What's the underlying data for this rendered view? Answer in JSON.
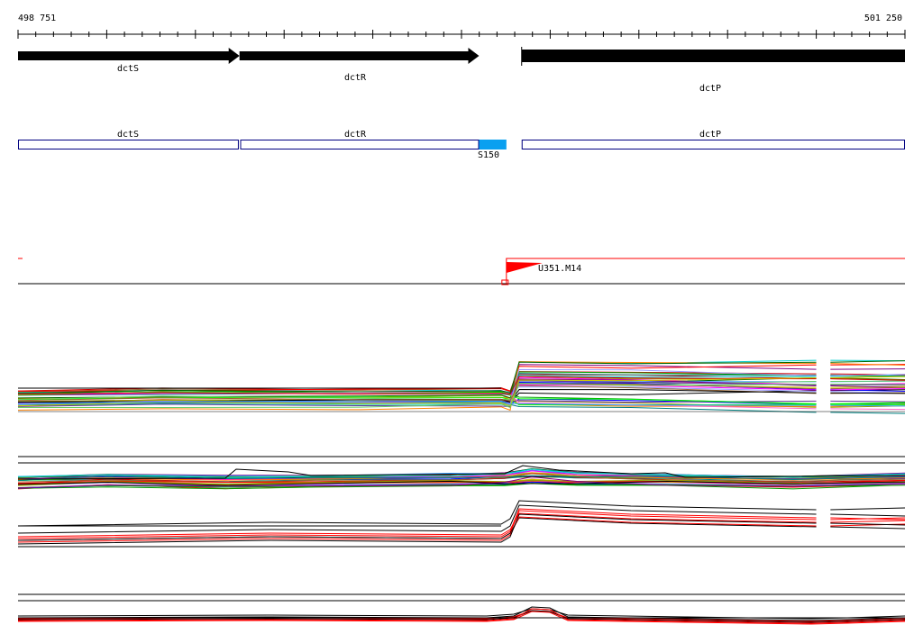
{
  "ruler": {
    "start_label": "498 751",
    "end_label": "501 250",
    "start": 498751,
    "end": 501250,
    "tick_count": 51
  },
  "genes": [
    {
      "id": "dctS",
      "label": "dctS",
      "start": 498751,
      "end": 499375,
      "strand": "+"
    },
    {
      "id": "dctR",
      "label": "dctR",
      "start": 499375,
      "end": 500050,
      "strand": "+"
    },
    {
      "id": "dctP",
      "label": "dctP",
      "start": 500170,
      "end": 501250,
      "strand": "none"
    }
  ],
  "annotations": [
    {
      "label": "dctS",
      "start": 498751,
      "end": 499373
    },
    {
      "label": "dctR",
      "start": 499377,
      "end": 500050
    },
    {
      "label": "dctP",
      "start": 500170,
      "end": 501250
    }
  ],
  "feature": {
    "label": "S150",
    "start": 500050,
    "end": 500127,
    "color": "#0aa0f0"
  },
  "tss": {
    "label": "U351.M14",
    "position": 500127,
    "color": "#ff0000"
  },
  "colors": {
    "gene": "#000000",
    "annotation": "#000080",
    "line": "#000000",
    "red": "#ff0000"
  },
  "palette": [
    "#ff0000",
    "#0000ff",
    "#00a000",
    "#ff00ff",
    "#00cccc",
    "#999900",
    "#800080",
    "#ff8000",
    "#008080",
    "#000000",
    "#00ff00",
    "#ff66cc",
    "#9999ff",
    "#cc0000",
    "#006600",
    "#663399",
    "#cccc00",
    "#3399ff",
    "#996633",
    "#66cc66"
  ],
  "expression_panels": [
    {
      "name": "panel-1",
      "series_count": 40,
      "gap": [
        501000,
        501040
      ]
    },
    {
      "name": "panel-2",
      "series_count": 30
    },
    {
      "name": "panel-3",
      "series_count": 8,
      "gap": [
        501000,
        501040
      ]
    },
    {
      "name": "panel-4",
      "series_count": 6
    }
  ]
}
